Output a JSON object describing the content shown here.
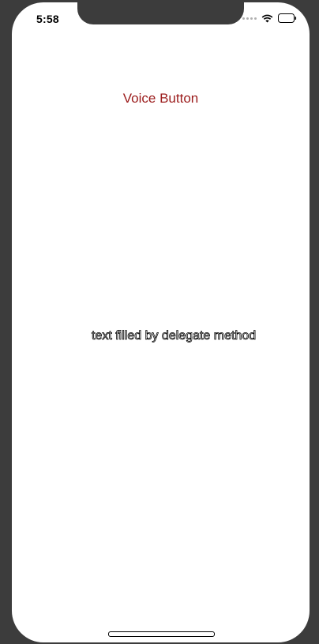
{
  "status_bar": {
    "time": "5:58",
    "wifi_icon": "wifi-icon",
    "battery_icon": "battery-icon"
  },
  "main": {
    "voice_button_label": "Voice Button",
    "result_text": "text filled by delegate method"
  },
  "colors": {
    "accent": "#9b1b1b",
    "background": "#ffffff",
    "device_frame": "#3c3c3c"
  }
}
